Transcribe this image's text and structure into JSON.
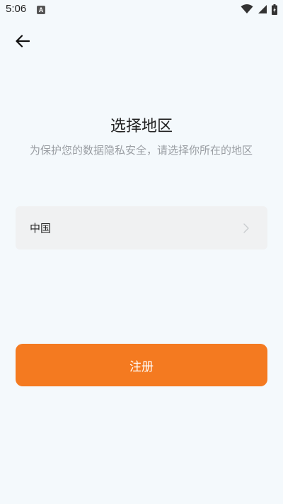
{
  "status_bar": {
    "time": "5:06",
    "notification_letter": "A",
    "icons": [
      "wifi-icon",
      "cell-signal-icon",
      "battery-charging-icon"
    ]
  },
  "header": {
    "back_icon": "arrow-left-icon"
  },
  "main": {
    "title": "选择地区",
    "subtitle": "为保护您的数据隐私安全，请选择你所在的地区",
    "region": {
      "value": "中国",
      "chevron_icon": "chevron-right-icon"
    },
    "register_label": "注册"
  },
  "colors": {
    "background": "#f4f9fc",
    "accent": "#f47a20",
    "field_bg": "#f0f1f2",
    "subtitle": "#9a9ea3"
  }
}
